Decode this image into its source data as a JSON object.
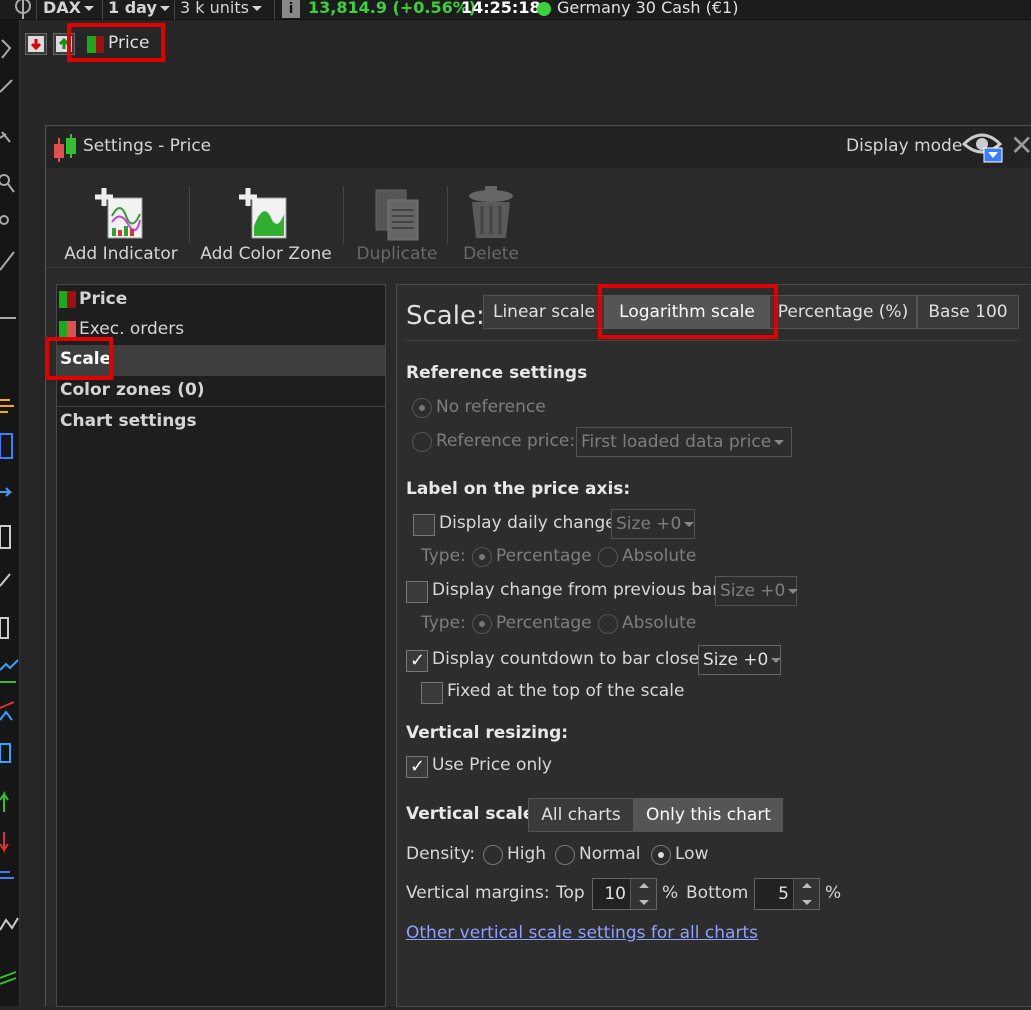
{
  "topbar": {
    "instrument": "DAX",
    "timeframe": "1 day",
    "units": "3 k units",
    "price": "13,814.9 (+0.56%)",
    "time": "14:25:18",
    "market_name": "Germany 30 Cash (€1)",
    "price_color": "#3bd13b"
  },
  "chart_tab": {
    "label": "Price"
  },
  "settings": {
    "title": "Settings - Price",
    "display_mode_label": "Display mode",
    "toolbar": {
      "add_indicator": "Add Indicator",
      "add_color_zone": "Add Color Zone",
      "duplicate": "Duplicate",
      "delete": "Delete"
    },
    "tree": {
      "items": [
        {
          "label": "Price"
        },
        {
          "label": "Exec. orders"
        },
        {
          "label": "Scale"
        },
        {
          "label": "Color zones (0)"
        },
        {
          "label": "Chart settings"
        }
      ]
    },
    "scale": {
      "label": "Scale:",
      "options": [
        "Linear scale",
        "Logarithm scale",
        "Percentage (%)",
        "Base 100"
      ],
      "selected": "Logarithm scale",
      "reference_header": "Reference settings",
      "no_reference": "No reference",
      "reference_price": "Reference price:",
      "reference_price_value": "First loaded data price",
      "label_header": "Label on the price axis:",
      "display_daily_change": "Display daily change",
      "size_value": "Size +0",
      "type_label": "Type:",
      "percentage": "Percentage",
      "absolute": "Absolute",
      "display_change_prev_bar": "Display change from previous bar",
      "display_countdown": "Display countdown to bar close",
      "fixed_top": "Fixed at the top of the scale",
      "vertical_resizing_header": "Vertical resizing:",
      "use_price_only": "Use Price only",
      "vertical_scale_label": "Vertical scale:",
      "all_charts": "All charts",
      "only_this_chart": "Only this chart",
      "density_label": "Density:",
      "high": "High",
      "normal": "Normal",
      "low": "Low",
      "vertical_margins_label": "Vertical margins:",
      "top_label": "Top",
      "top_value": "10",
      "percent_sign": "%",
      "bottom_label": "Bottom",
      "bottom_value": "5",
      "other_settings_link": "Other vertical scale settings for all charts"
    }
  },
  "colors": {
    "highlight": "#e00000",
    "link": "#8fa0ff"
  }
}
